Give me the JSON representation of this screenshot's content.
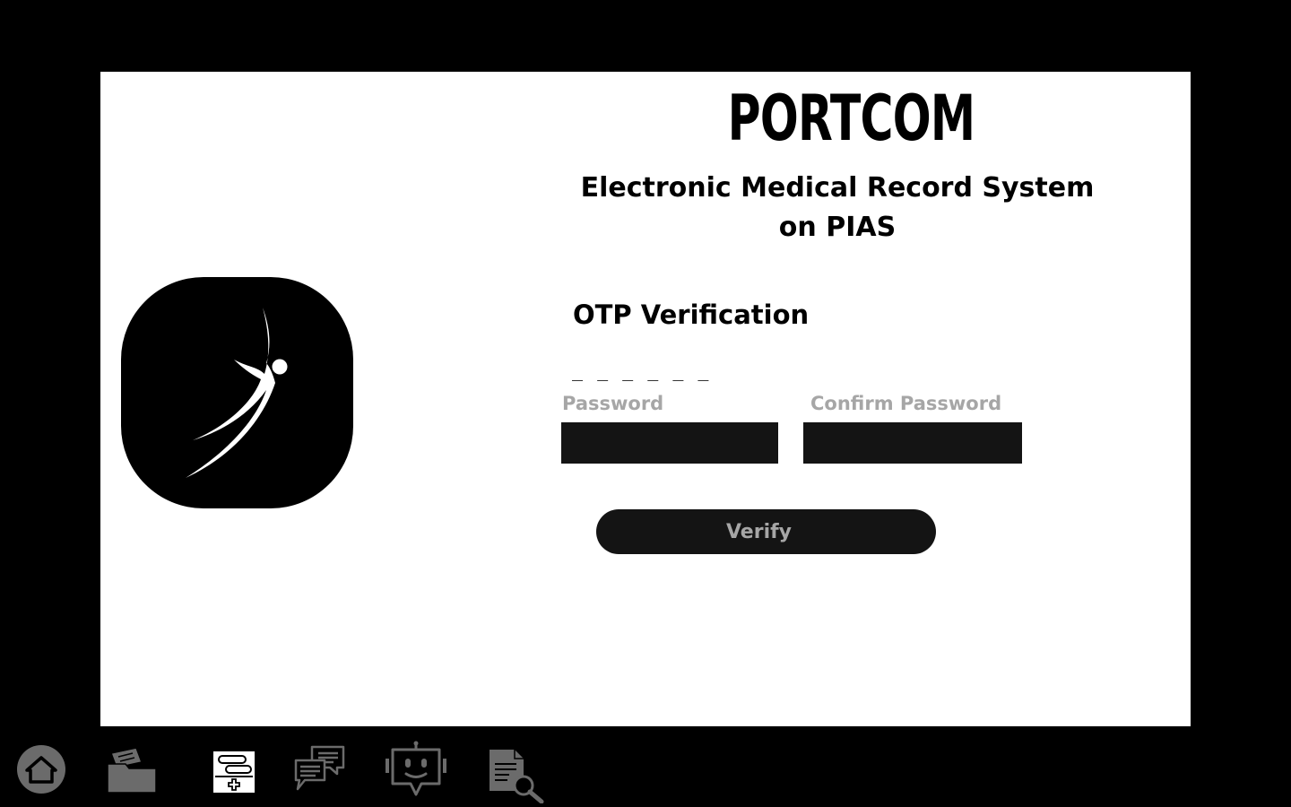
{
  "app": {
    "brand": "PORTCOM",
    "subtitle": "Electronic Medical Record System on PIAS"
  },
  "otp": {
    "title": "OTP Verification",
    "placeholder": "_ _ _ _ _ _",
    "value": ""
  },
  "password": {
    "label": "Password",
    "value": ""
  },
  "confirm_password": {
    "label": "Confirm Password",
    "value": ""
  },
  "verify": {
    "label": "Verify"
  },
  "logo": {
    "icon": "dancer-figure-icon"
  },
  "taskbar": {
    "items": [
      {
        "icon": "home-icon"
      },
      {
        "icon": "folder-icon"
      },
      {
        "icon": "medical-record-icon",
        "active": true
      },
      {
        "icon": "chat-icon"
      },
      {
        "icon": "robot-icon"
      },
      {
        "icon": "document-search-icon"
      }
    ]
  },
  "colors": {
    "background": "#000000",
    "card": "#ffffff",
    "field": "#141414",
    "label_gray": "#a6a6a6",
    "taskbar_icon": "#6b6b6b"
  }
}
